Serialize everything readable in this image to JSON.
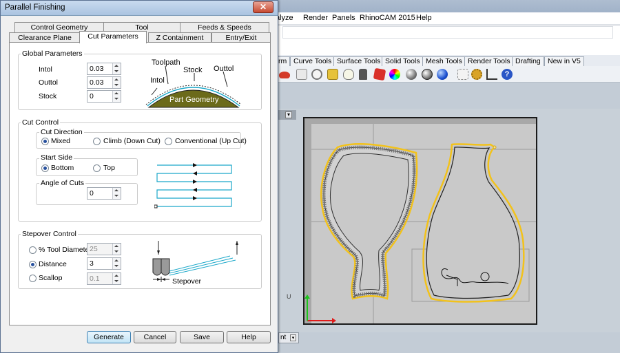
{
  "dialog": {
    "title": "Parallel Finishing",
    "close_glyph": "✕",
    "tabs_row1": [
      "Control Geometry",
      "Tool",
      "Feeds & Speeds"
    ],
    "tabs_row2": [
      "Clearance Plane",
      "Cut Parameters",
      "Z Containment",
      "Entry/Exit"
    ],
    "active_tab": "Cut Parameters",
    "global": {
      "label": "Global Parameters",
      "intol_label": "Intol",
      "intol_value": "0.03",
      "outtol_label": "Outtol",
      "outtol_value": "0.03",
      "stock_label": "Stock",
      "stock_value": "0",
      "diagram": {
        "toolpath": "Toolpath",
        "stock": "Stock",
        "outtol": "Outtol",
        "intol": "Intol",
        "part": "Part Geometry"
      }
    },
    "cut_control": {
      "label": "Cut Control",
      "direction_label": "Cut Direction",
      "directions": [
        "Mixed",
        "Climb (Down Cut)",
        "Conventional (Up Cut)"
      ],
      "direction_selected": "Mixed",
      "start_side_label": "Start Side",
      "start_sides": [
        "Bottom",
        "Top"
      ],
      "start_side_selected": "Bottom",
      "angle_label": "Angle of Cuts",
      "angle_value": "0"
    },
    "stepover": {
      "label": "Stepover Control",
      "tool_diameter_label": "% Tool Diameter",
      "tool_diameter_value": "25",
      "distance_label": "Distance",
      "distance_value": "3",
      "scallop_label": "Scallop",
      "scallop_value": "0.1",
      "selected": "Distance",
      "diagram_label": "Stepover"
    },
    "buttons": {
      "generate": "Generate",
      "cancel": "Cancel",
      "save": "Save",
      "help": "Help"
    }
  },
  "background_app": {
    "menu": [
      "alyze",
      "Render",
      "Panels",
      "RhinoCAM 2015",
      "Help"
    ],
    "toolbar_tabs": [
      "rm",
      "Curve Tools",
      "Surface Tools",
      "Solid Tools",
      "Mesh Tools",
      "Render Tools",
      "Drafting",
      "New in V5"
    ],
    "viewport_tab": "nt",
    "axis_label": "U"
  },
  "colors": {
    "accent": "#27509e",
    "part_fill": "#6b6a1a",
    "toolpath": "#1aa7c9",
    "curve_highlight": "#f2c21b"
  }
}
